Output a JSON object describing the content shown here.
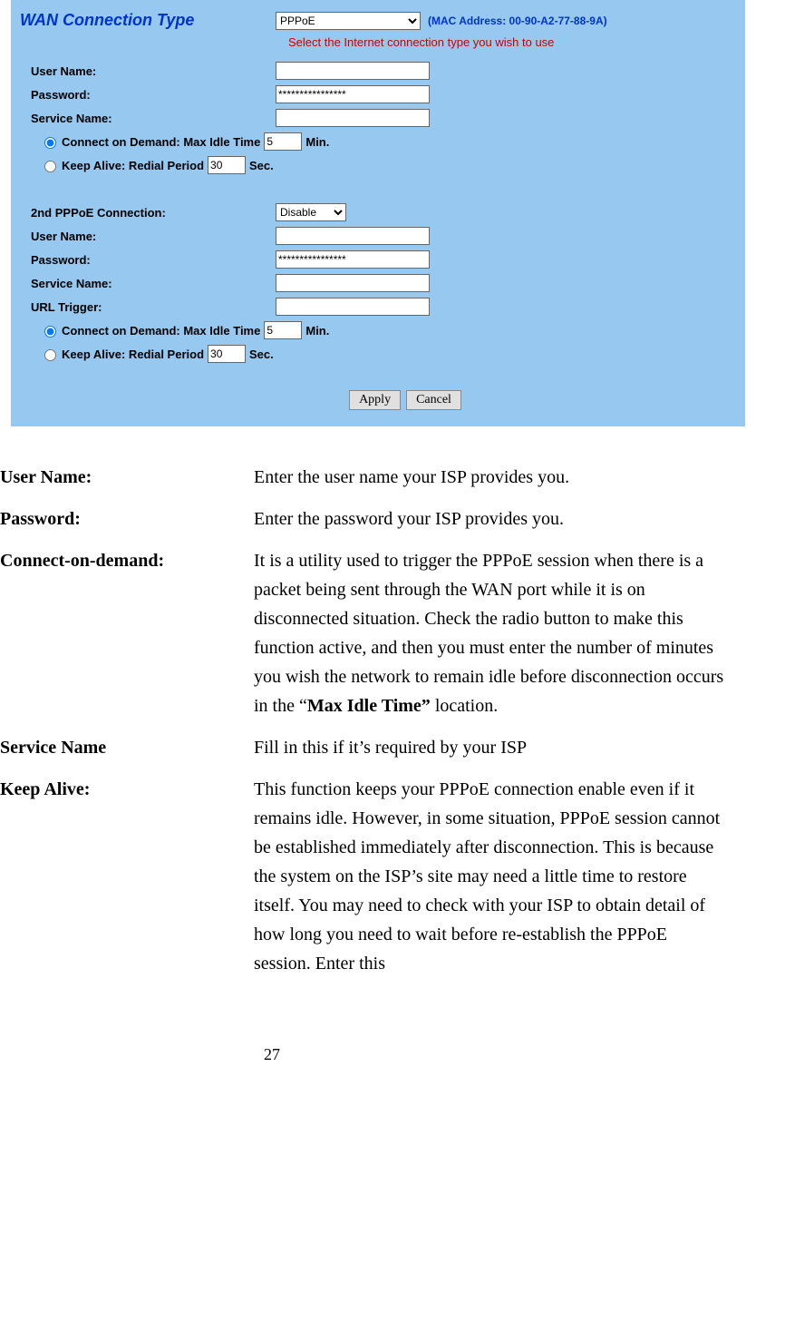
{
  "form": {
    "title": "WAN Connection Type",
    "wan_type_selected": "PPPoE",
    "mac_label": "(MAC Address: 00-90-A2-77-88-9A)",
    "select_note": "Select the Internet connection type you wish to use",
    "labels": {
      "user_name": "User Name:",
      "password": "Password:",
      "service_name": "Service Name:",
      "second_conn": "2nd PPPoE Connection:",
      "url_trigger": "URL Trigger:",
      "connect_demand_prefix": "Connect on Demand: Max Idle Time",
      "connect_demand_suffix": "Min.",
      "keep_alive_prefix": "Keep Alive: Redial Period",
      "keep_alive_suffix": "Sec."
    },
    "values": {
      "user1": "",
      "pass1": "****************",
      "service1": "",
      "idle1": "5",
      "redial1": "30",
      "second_selected": "Disable",
      "user2": "",
      "pass2": "****************",
      "service2": "",
      "url_trigger": "",
      "idle2": "5",
      "redial2": "30"
    },
    "buttons": {
      "apply": "Apply",
      "cancel": "Cancel"
    }
  },
  "doc": {
    "defs": [
      {
        "term": "User Name:",
        "desc": "Enter the user name your ISP provides you."
      },
      {
        "term": "Password:",
        "desc": "Enter the password your ISP provides you."
      },
      {
        "term": "Connect-on-demand:",
        "desc_pre": "It is a utility used to trigger the PPPoE session when there is a packet being sent through the WAN port while it is on disconnected situation. Check the radio button to make this function active, and then you must enter the number of minutes you wish the network to remain idle before disconnection occurs in the “",
        "bold": "Max Idle Time”",
        "desc_post": " location."
      },
      {
        "term": "Service Name",
        "desc": "Fill in this if it’s required by your ISP"
      },
      {
        "term": "Keep Alive:",
        "desc": "This function keeps your PPPoE connection enable even if it remains idle. However, in some situation, PPPoE session cannot be established immediately after disconnection. This is because the system on the ISP’s site may need a little time to restore itself. You may need to check with your ISP to obtain detail of how long you need to wait before re-establish the PPPoE session. Enter this"
      }
    ],
    "page": "27"
  }
}
